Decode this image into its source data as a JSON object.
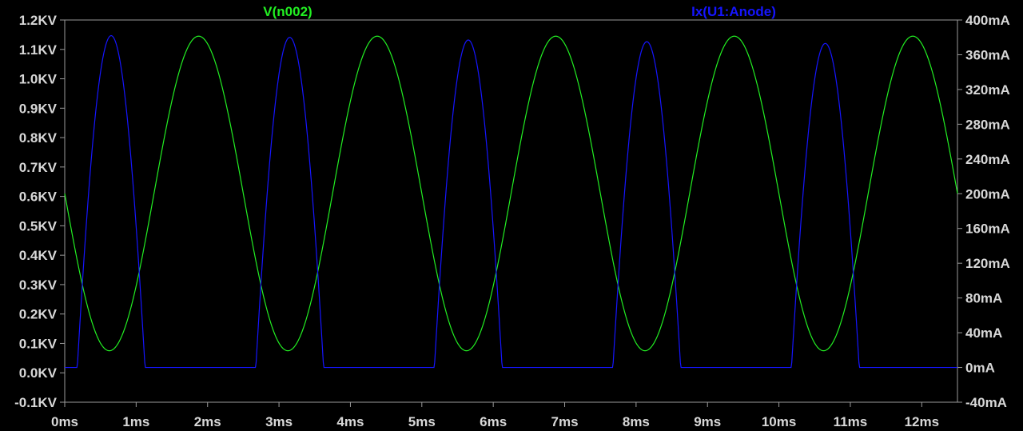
{
  "window": {
    "background": "#000000",
    "axis_color": "#9a9a9a",
    "text_color": "#d8d8d8"
  },
  "chart_data": {
    "type": "line",
    "xlabel": "",
    "x_ticks": [
      "0ms",
      "1ms",
      "2ms",
      "3ms",
      "4ms",
      "5ms",
      "6ms",
      "7ms",
      "8ms",
      "9ms",
      "10ms",
      "11ms",
      "12ms"
    ],
    "xlim_ms": [
      0,
      12.5
    ],
    "left_axis": {
      "unit": "KV",
      "ylim": [
        -0.1,
        1.2
      ],
      "ticks": [
        "-0.1KV",
        "0.0KV",
        "0.1KV",
        "0.2KV",
        "0.3KV",
        "0.4KV",
        "0.5KV",
        "0.6KV",
        "0.7KV",
        "0.8KV",
        "0.9KV",
        "1.0KV",
        "1.1KV",
        "1.2KV"
      ]
    },
    "right_axis": {
      "unit": "mA",
      "ylim": [
        -40,
        400
      ],
      "ticks": [
        "-40mA",
        "0mA",
        "40mA",
        "80mA",
        "120mA",
        "160mA",
        "200mA",
        "240mA",
        "280mA",
        "320mA",
        "360mA",
        "400mA"
      ]
    },
    "series": [
      {
        "name": "V(n002)",
        "color": "#22ee22",
        "axis": "left",
        "description": "sinusoid, period 2.5ms",
        "max": 1.145,
        "min": 0.075,
        "start_value": 0.6,
        "first_peak_ms": 1.875
      },
      {
        "name": "Ix(U1:Anode)",
        "color": "#1515ff",
        "axis": "right",
        "description": "clipped sinusoid, zero floor",
        "peaks": [
          [
            0.65,
            382
          ],
          [
            3.15,
            380
          ],
          [
            5.65,
            377
          ],
          [
            8.15,
            375
          ],
          [
            10.65,
            373
          ]
        ],
        "start_value": 40,
        "floor": 0
      }
    ]
  }
}
